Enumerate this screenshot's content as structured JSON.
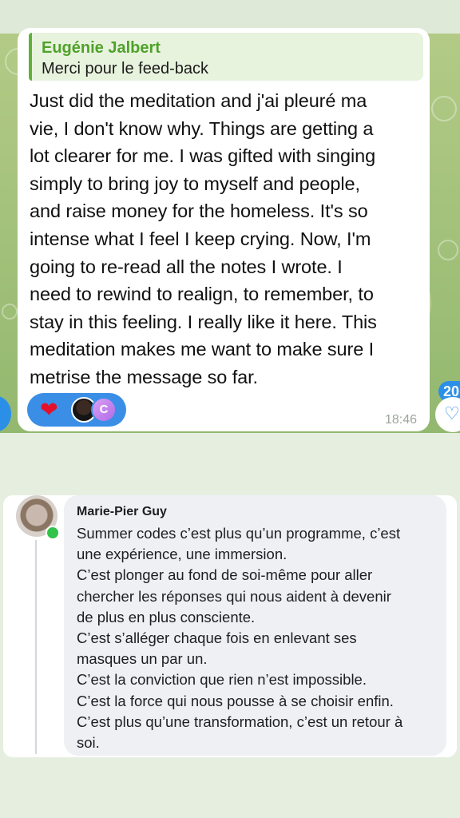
{
  "telegram": {
    "reply": {
      "name": "Eugénie Jalbert",
      "text": "Merci pour le feed-back"
    },
    "message_lines": [
      "Just did the meditation and j'ai pleuré ma",
      "vie, I don't know why. Things are getting a",
      "lot clearer for me. I was gifted with singing",
      "simply to bring joy to myself and people,",
      "and raise money for the homeless. It's so",
      "intense what I feel I keep crying. Now, I'm",
      "going to re-read all the notes I wrote. I",
      "need to rewind to realign, to remember, to",
      "stay in this feeling. I really like it here. This",
      "meditation makes me want to make sure I",
      "metrise  the message so far."
    ],
    "reactions": {
      "emoji": "❤",
      "avatar_letter": "C"
    },
    "time": "18:46",
    "side_badge": "20",
    "colors": {
      "reply_name": "#4fa22a",
      "reaction_pill": "#3a8ee6"
    }
  },
  "facebook_comment": {
    "author": "Marie-Pier Guy",
    "lines": [
      "Summer codes c’est plus qu’un programme, c’est",
      "une expérience, une immersion.",
      "C’est plonger au fond de soi-même pour aller",
      "chercher les réponses qui nous aident à devenir",
      "de plus en plus consciente.",
      "C’est s’alléger chaque fois en enlevant ses",
      "masques un par un.",
      "C’est la conviction que rien n’est impossible.",
      "C’est la force qui nous pousse à se choisir enfin.",
      "C’est plus qu’une transformation, c’est un retour à",
      "soi."
    ],
    "online_status": "online",
    "colors": {
      "online": "#31c24a"
    }
  }
}
